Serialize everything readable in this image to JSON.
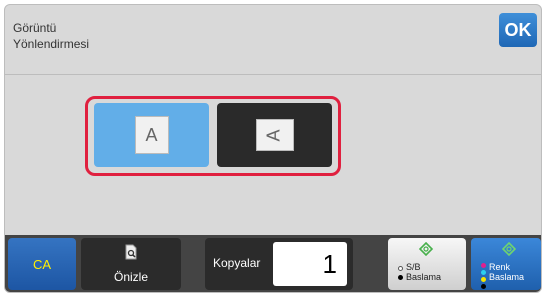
{
  "header": {
    "title_line1": "Görüntü",
    "title_line2": "Yönlendirmesi",
    "ok_label": "OK"
  },
  "orientation": {
    "selected": "portrait",
    "portrait_glyph": "A",
    "landscape_glyph": "A"
  },
  "footer": {
    "ca_label": "CA",
    "preview_label": "Önizle",
    "copies_label": "Kopyalar",
    "copies_value": "1",
    "bw_start_line1": "S/B",
    "bw_start_line2": "Baslama",
    "color_start_line1": "Renk",
    "color_start_line2": "Baslama"
  },
  "colors": {
    "accent": "#1f67b5",
    "selected": "#62aee8",
    "highlight": "#e0203f",
    "ca_text": "#fff000"
  }
}
